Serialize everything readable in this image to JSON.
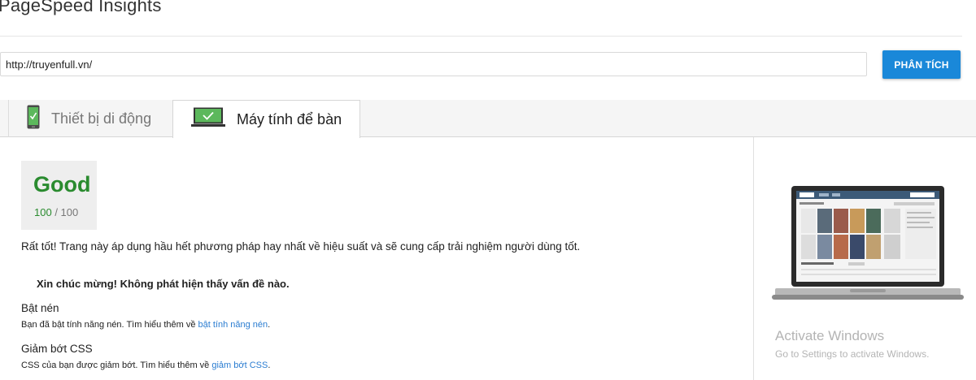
{
  "app": {
    "title": "PageSpeed Insights"
  },
  "search": {
    "url_value": "http://truyenfull.vn/",
    "analyze_label": "PHÂN TÍCH"
  },
  "tabs": [
    {
      "label": "Thiết bị di động",
      "icon": "phone-icon",
      "selected": false
    },
    {
      "label": "Máy tính để bàn",
      "icon": "monitor-icon",
      "selected": true
    }
  ],
  "score": {
    "label": "Good",
    "value": "100",
    "max": "/ 100",
    "color": "#2a8b2f"
  },
  "summary": "Rất tốt! Trang này áp dụng hầu hết phương pháp hay nhất về hiệu suất và sẽ cung cấp trải nghiệm người dùng tốt.",
  "congrats": "Xin chúc mừng! Không phát hiện thấy vấn đề nào.",
  "rules": [
    {
      "title": "Bật nén",
      "desc": "Bạn đã bật tính năng nén. Tìm hiểu thêm về ",
      "link_text": "bật tính năng nén",
      "suffix": "."
    },
    {
      "title": "Giảm bớt CSS",
      "desc": "CSS của bạn được giảm bớt. Tìm hiểu thêm về ",
      "link_text": "giảm bớt CSS",
      "suffix": "."
    }
  ],
  "preview": {
    "icon": "laptop-screenshot-preview"
  },
  "watermark": {
    "title": "Activate Windows",
    "subtitle": "Go to Settings to activate Windows."
  },
  "colors": {
    "accent": "#1a88d9",
    "good": "#2a8b2f",
    "link": "#2b7dd1"
  }
}
